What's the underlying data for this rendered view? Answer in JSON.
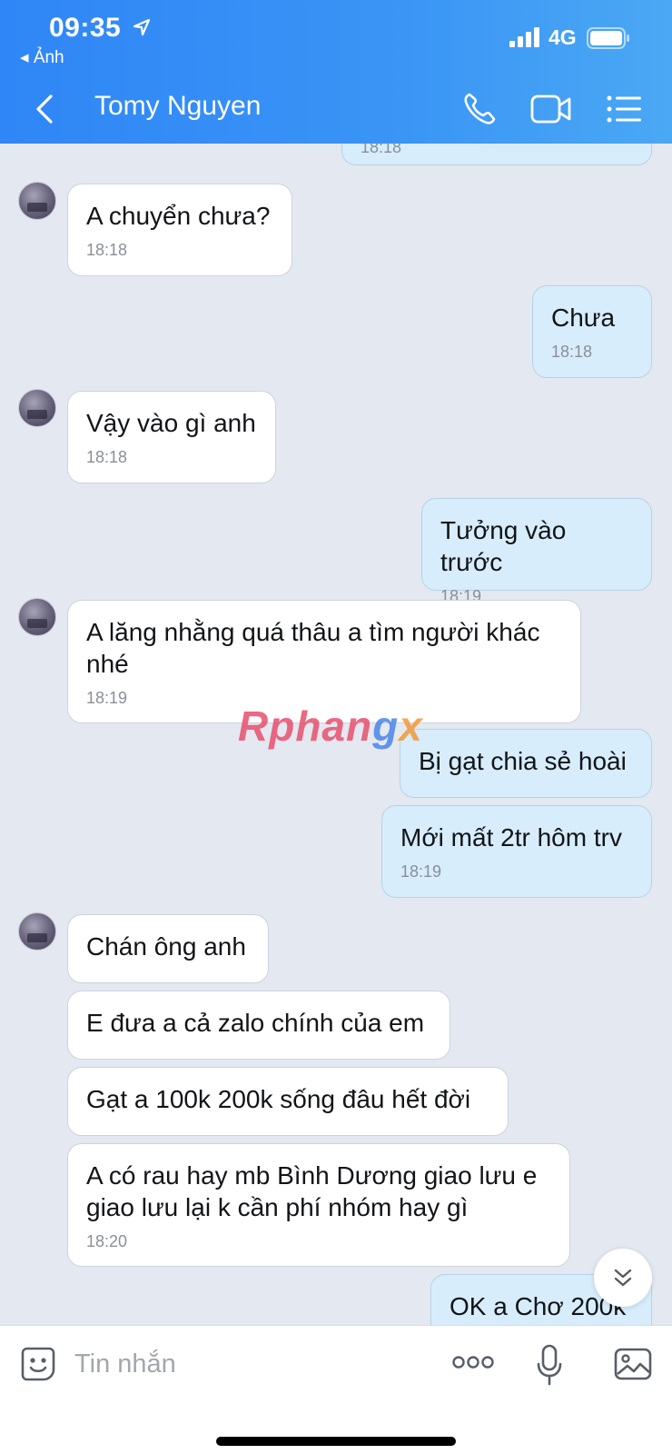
{
  "status_bar": {
    "time": "09:35",
    "back_app": "◂ Ảnh",
    "network": "4G"
  },
  "header": {
    "contact_name": "Tomy Nguyen"
  },
  "messages": [
    {
      "dir": "out",
      "text": "",
      "time": "18:18"
    },
    {
      "dir": "in",
      "text": "A chuyển chưa?",
      "time": "18:18"
    },
    {
      "dir": "out",
      "text": "Chưa",
      "time": "18:18"
    },
    {
      "dir": "in",
      "text": "Vậy vào gì anh",
      "time": "18:18"
    },
    {
      "dir": "out",
      "text": "Tưởng vào trước",
      "time": "18:19"
    },
    {
      "dir": "in",
      "text": "A lăng nhằng quá thâu a tìm người khác nhé",
      "time": "18:19"
    },
    {
      "dir": "out",
      "text": "Bị gạt chia sẻ hoài",
      "time": ""
    },
    {
      "dir": "out",
      "text": "Mới mất 2tr hôm trv",
      "time": "18:19"
    },
    {
      "dir": "in",
      "text": "Chán ông anh",
      "time": ""
    },
    {
      "dir": "in",
      "text": "E đưa a cả zalo chính của em",
      "time": ""
    },
    {
      "dir": "in",
      "text": "Gạt a 100k 200k sống đâu hết đời",
      "time": ""
    },
    {
      "dir": "in",
      "text": "A có rau hay mb Bình Dương giao lưu e giao lưu lại k cần phí nhóm hay gì",
      "time": "18:20"
    },
    {
      "dir": "out",
      "text": "OK a Chơ 200k",
      "time": ""
    }
  ],
  "watermark": {
    "part1": "Rphan",
    "part2": "g",
    "part3": "x"
  },
  "input": {
    "placeholder": "Tin nhắn"
  },
  "colors": {
    "header_blue": "#2f86f6",
    "outgoing_bubble": "#d7edfb",
    "incoming_bubble": "#ffffff",
    "chat_bg": "#e4e8f0"
  }
}
